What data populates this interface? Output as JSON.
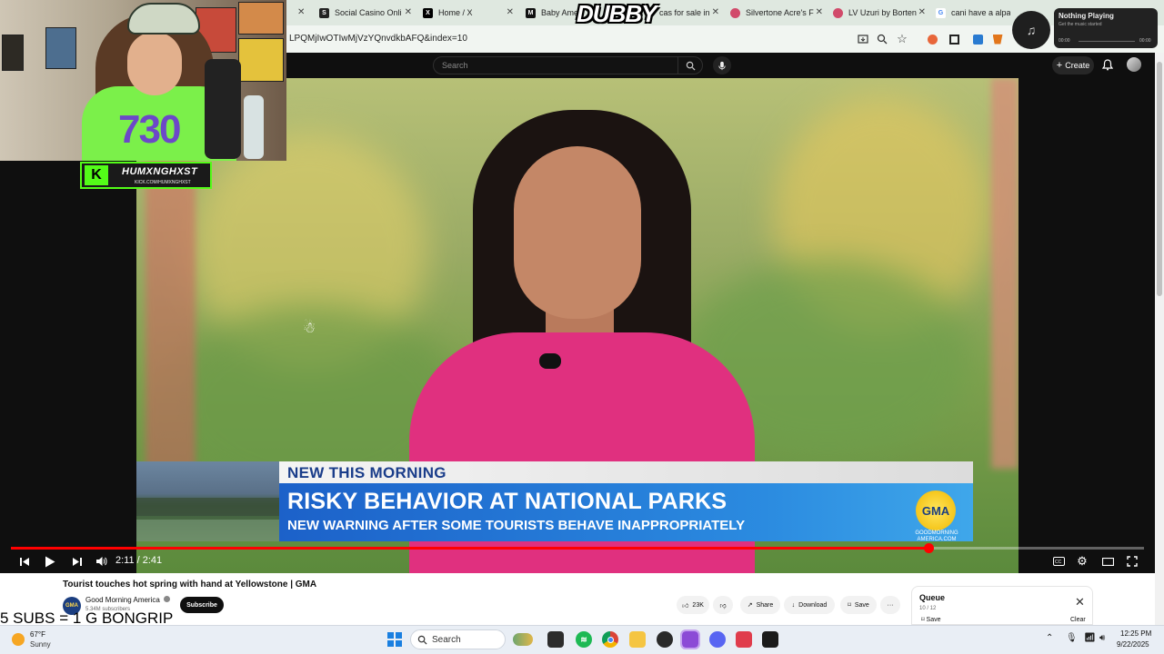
{
  "browser": {
    "tabs": [
      {
        "label": "Social Casino Onli",
        "icon": "s-icon",
        "color": "#222"
      },
      {
        "label": "Home / X",
        "icon": "x-icon",
        "color": "#000"
      },
      {
        "label": "Baby Amer",
        "icon": "mail-icon",
        "color": "#111"
      },
      {
        "label": "cas for sale in",
        "icon": "",
        "color": ""
      },
      {
        "label": "Silvertone Acre's F",
        "icon": "circle-icon",
        "color": "#d14a6a"
      },
      {
        "label": "LV Uzuri by Borten",
        "icon": "circle-icon",
        "color": "#d14a6a"
      },
      {
        "label": "cani have a alpaca",
        "icon": "google-icon",
        "color": "#4285f4"
      }
    ],
    "url": "LPQMjIwOTIwMjVzYQnvdkbAFQ&index=10"
  },
  "youtube": {
    "search_placeholder": "Search",
    "create_label": "Create",
    "video": {
      "lower_third_top": "NEW THIS MORNING",
      "lower_third_headline": "RISKY BEHAVIOR AT NATIONAL PARKS",
      "lower_third_sub": "NEW WARNING AFTER SOME TOURISTS BEHAVE INAPPROPRIATELY",
      "logo_text": "GMA",
      "logo_sub": "GOODMORNING AMERICA.COM",
      "time": "2:11 / 2:41",
      "progress": 0.81
    },
    "title": "Tourist touches hot spring with hand at Yellowstone | GMA",
    "channel": {
      "name": "Good Morning America",
      "subs": "5.34M subscribers",
      "avatar_text": "GMA",
      "subscribe_label": "Subscribe"
    },
    "actions": {
      "likes": "23K",
      "share": "Share",
      "download": "Download",
      "save": "Save"
    },
    "queue": {
      "title": "Queue",
      "count": "10 / 12",
      "save": "Save",
      "clear": "Clear"
    }
  },
  "overlay": {
    "dubby": "DUBBY",
    "kick_name": "HUMXNGHXST",
    "kick_url": "KICK.COM/HUMXNGHXST",
    "shirt_number": "730",
    "music_title": "Nothing Playing",
    "music_sub": "Get the music started",
    "music_start": "00:00",
    "music_end": "00:00",
    "subs_text": "5 SUBS = 1 G BONGRIP"
  },
  "taskbar": {
    "temp": "67°F",
    "condition": "Sunny",
    "search": "Search",
    "time": "12:25 PM",
    "date": "9/22/2025"
  },
  "colors": {
    "progress": "#ff0000",
    "kick_green": "#53fc18",
    "gma_blue": "#1c61c9"
  }
}
